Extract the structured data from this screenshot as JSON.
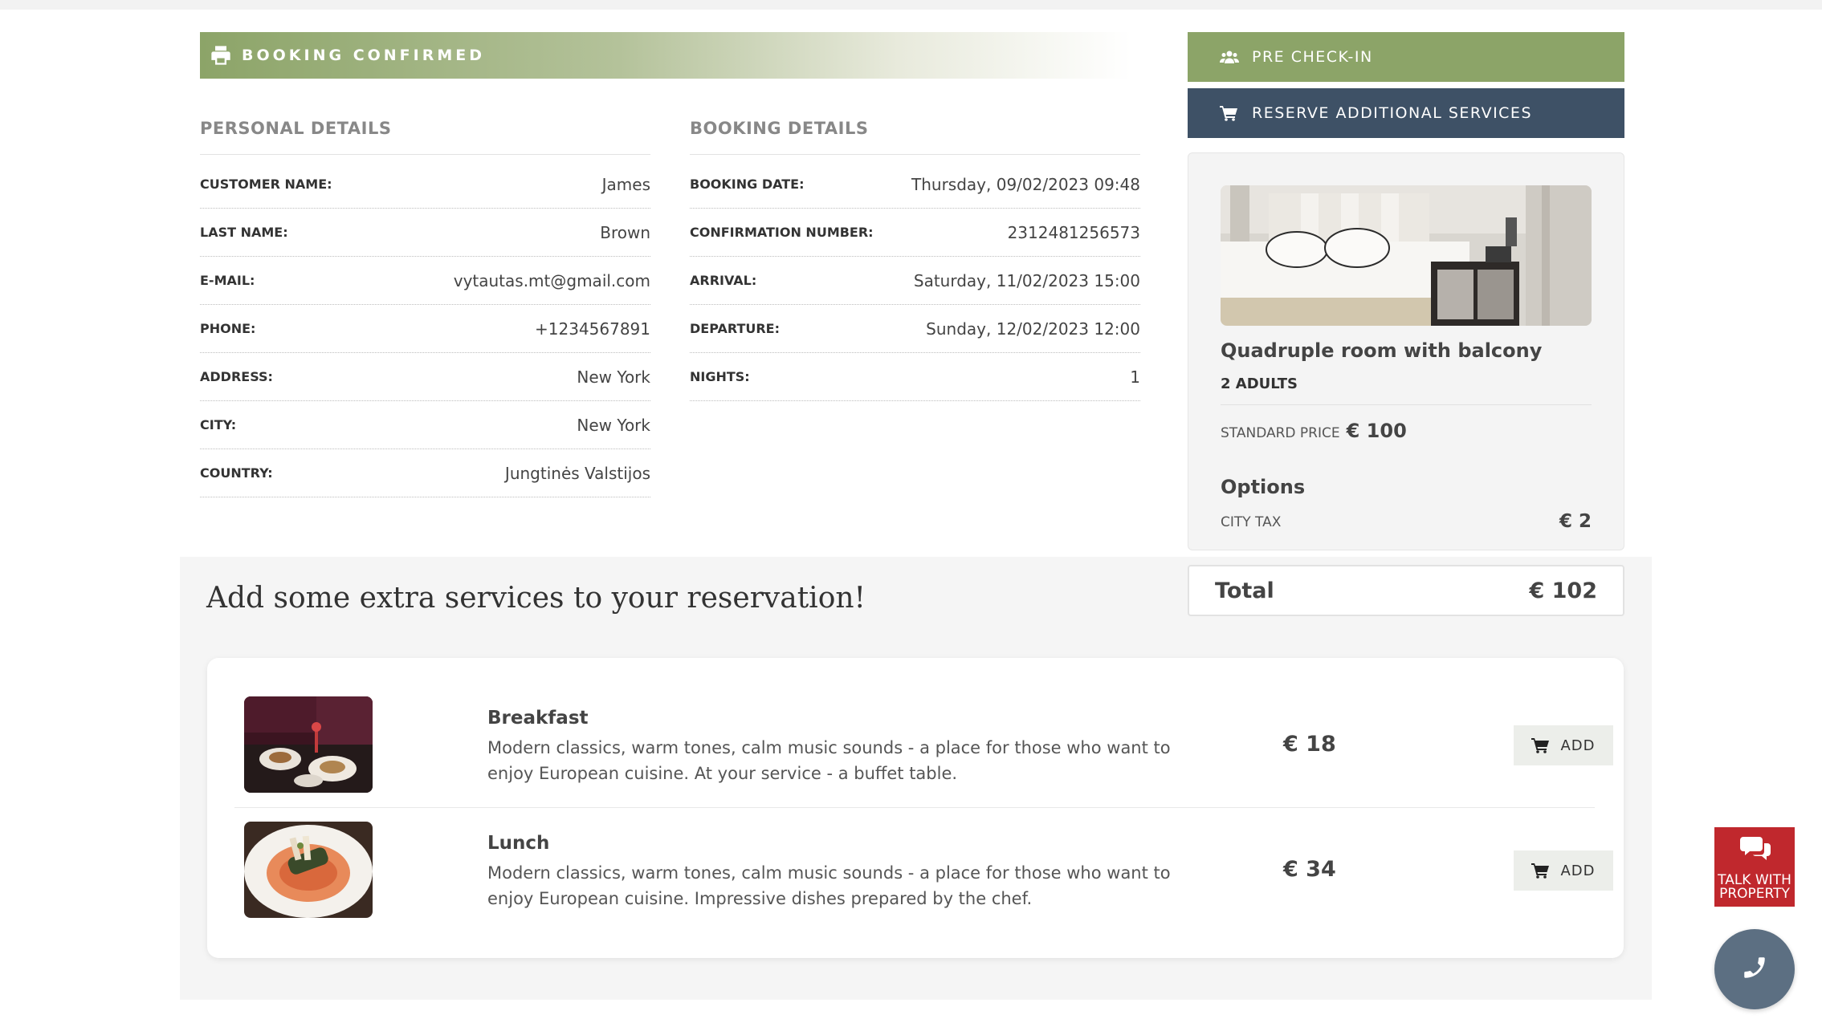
{
  "banner": {
    "title": "BOOKING CONFIRMED",
    "icon": "printer-icon"
  },
  "personal": {
    "title": "PERSONAL DETAILS",
    "rows": [
      {
        "label": "CUSTOMER NAME:",
        "value": "James"
      },
      {
        "label": "LAST NAME:",
        "value": "Brown"
      },
      {
        "label": "E-MAIL:",
        "value": "vytautas.mt@gmail.com"
      },
      {
        "label": "PHONE:",
        "value": "+1234567891"
      },
      {
        "label": "ADDRESS:",
        "value": "New York"
      },
      {
        "label": "CITY:",
        "value": "New York"
      },
      {
        "label": "COUNTRY:",
        "value": "Jungtinės Valstijos"
      }
    ]
  },
  "booking": {
    "title": "BOOKING DETAILS",
    "rows": [
      {
        "label": "BOOKING DATE:",
        "value": "Thursday, 09/02/2023 09:48"
      },
      {
        "label": "CONFIRMATION NUMBER:",
        "value": "2312481256573"
      },
      {
        "label": "ARRIVAL:",
        "value": "Saturday, 11/02/2023 15:00"
      },
      {
        "label": "DEPARTURE:",
        "value": "Sunday, 12/02/2023 12:00"
      },
      {
        "label": "NIGHTS:",
        "value": "1"
      }
    ]
  },
  "actions": {
    "precheckin": {
      "label": "PRE CHECK-IN",
      "icon": "users-icon",
      "color": "#8ca468"
    },
    "reserve": {
      "label": "RESERVE ADDITIONAL SERVICES",
      "icon": "cart-icon",
      "color": "#3e5166"
    }
  },
  "room": {
    "name": "Quadruple room with balcony",
    "guests": "2 ADULTS",
    "price_label": "STANDARD PRICE",
    "price": "€ 100",
    "options_title": "Options",
    "tax_label": "CITY TAX",
    "tax_value": "€ 2"
  },
  "total": {
    "label": "Total",
    "value": "€ 102"
  },
  "extras": {
    "title": "Add some extra services to your reservation!",
    "items": [
      {
        "name": "Breakfast",
        "desc": "Modern classics, warm tones, calm music sounds - a place for those who want to enjoy European cuisine. At your service - a buffet table.",
        "price": "€ 18",
        "add_label": "ADD"
      },
      {
        "name": "Lunch",
        "desc": "Modern classics, warm tones, calm music sounds - a place for those who want to enjoy European cuisine. Impressive dishes prepared by the chef.",
        "price": "€ 34",
        "add_label": "ADD"
      }
    ]
  },
  "widgets": {
    "talk_label": "TALK WITH PROPERTY",
    "talk_icon": "chat-icon",
    "phone_icon": "phone-icon",
    "accent": "#c0282d"
  }
}
